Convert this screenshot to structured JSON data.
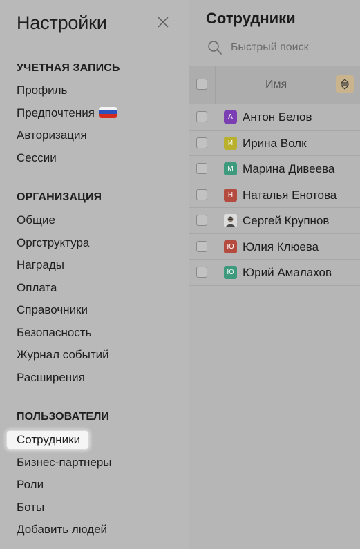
{
  "sidebar": {
    "title": "Настройки",
    "sections": {
      "account": {
        "title": "УЧЕТНАЯ ЗАПИСЬ",
        "items": [
          "Профиль",
          "Предпочтения",
          "Авторизация",
          "Сессии"
        ]
      },
      "organization": {
        "title": "ОРГАНИЗАЦИЯ",
        "items": [
          "Общие",
          "Оргструктура",
          "Награды",
          "Оплата",
          "Справочники",
          "Безопасность",
          "Журнал событий",
          "Расширения"
        ]
      },
      "users": {
        "title": "ПОЛЬЗОВАТЕЛИ",
        "items": [
          "Сотрудники",
          "Бизнес-партнеры",
          "Роли",
          "Боты",
          "Добавить людей"
        ],
        "active_item": "Сотрудники"
      }
    },
    "flag_colors": [
      "#f4f4f4",
      "#2a52be",
      "#d52b1e"
    ]
  },
  "main": {
    "title": "Сотрудники",
    "search_placeholder": "Быстрый поиск",
    "table": {
      "column_header": "Имя",
      "rows": [
        {
          "name": "Антон Белов",
          "initial": "А",
          "color": "#7b3fb3"
        },
        {
          "name": "Ирина Волк",
          "initial": "И",
          "color": "#b9b12e"
        },
        {
          "name": "Марина Дивеева",
          "initial": "М",
          "color": "#3e9a7d"
        },
        {
          "name": "Наталья Енотова",
          "initial": "Н",
          "color": "#b54a3e"
        },
        {
          "name": "Сергей Крупнов",
          "initial": "",
          "color": "#d6d6d6"
        },
        {
          "name": "Юлия Клюева",
          "initial": "Ю",
          "color": "#b54a3e"
        },
        {
          "name": "Юрий Амалахов",
          "initial": "Ю",
          "color": "#3e9a7d"
        }
      ]
    }
  }
}
